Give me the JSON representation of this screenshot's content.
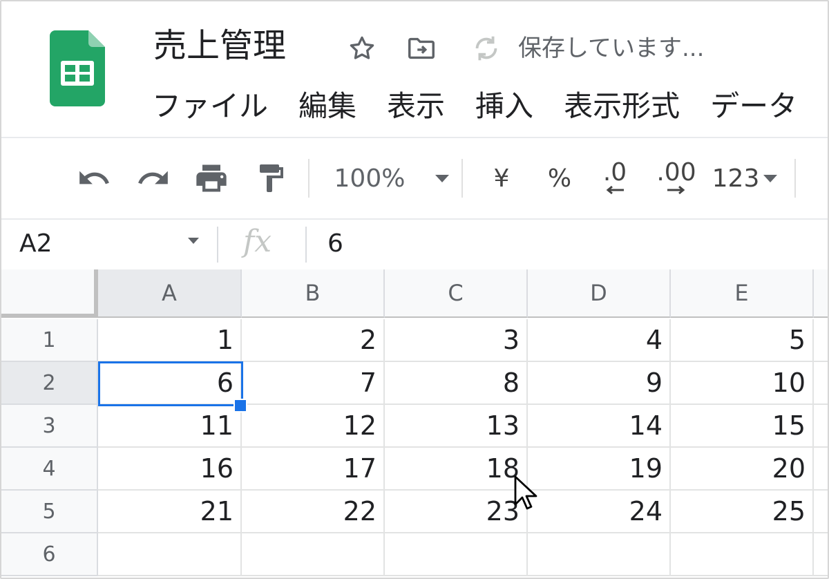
{
  "doc": {
    "title": "売上管理",
    "status": "保存しています..."
  },
  "menu": [
    "ファイル",
    "編集",
    "表示",
    "挿入",
    "表示形式",
    "データ"
  ],
  "toolbar": {
    "zoom": "100%",
    "currency": "¥",
    "percent": "%",
    "decrease_decimal": ".0",
    "increase_decimal": ".00",
    "more_formats": "123"
  },
  "formula_bar": {
    "name_box": "A2",
    "fx": "fx",
    "value": "6"
  },
  "sheet": {
    "columns": [
      "A",
      "B",
      "C",
      "D",
      "E"
    ],
    "rows": [
      "1",
      "2",
      "3",
      "4",
      "5",
      "6"
    ],
    "cells": [
      [
        "1",
        "2",
        "3",
        "4",
        "5"
      ],
      [
        "6",
        "7",
        "8",
        "9",
        "10"
      ],
      [
        "11",
        "12",
        "13",
        "14",
        "15"
      ],
      [
        "16",
        "17",
        "18",
        "19",
        "20"
      ],
      [
        "21",
        "22",
        "23",
        "24",
        "25"
      ],
      [
        "",
        "",
        "",
        "",
        ""
      ]
    ],
    "selected_cell": "A2"
  },
  "colors": {
    "accent": "#1a73e8",
    "sheets_green": "#23a566"
  }
}
